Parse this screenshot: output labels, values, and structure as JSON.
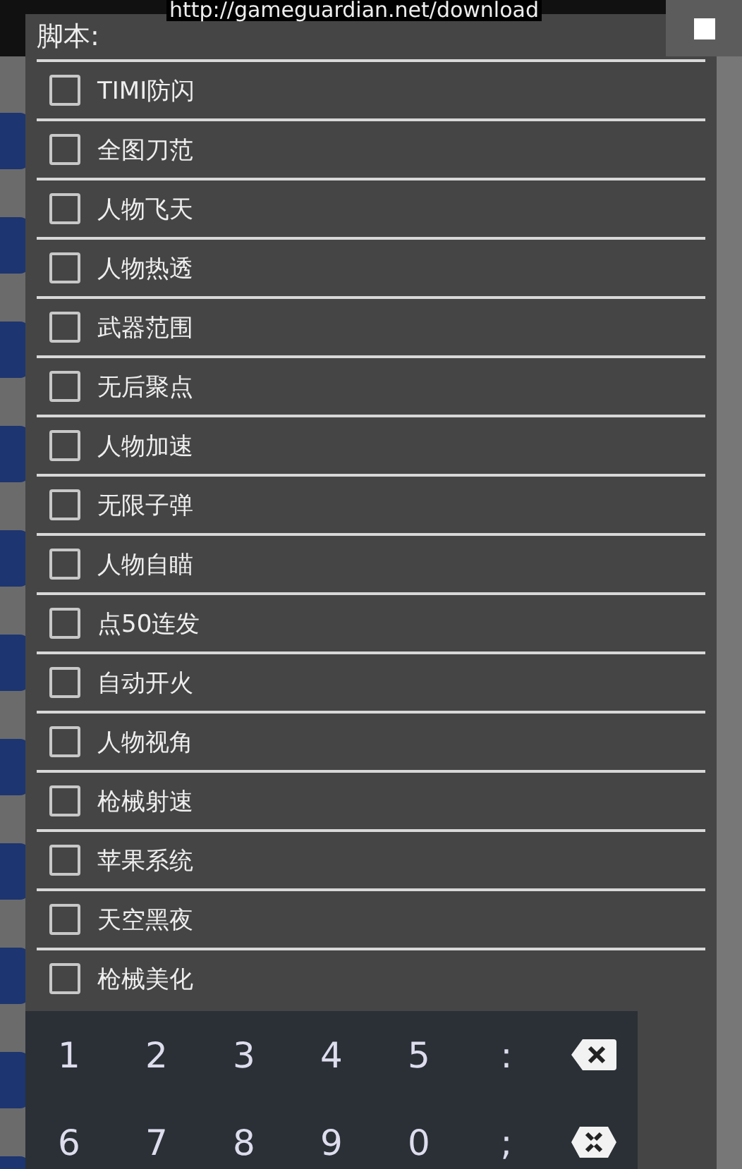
{
  "url_banner": "http://gameguardian.net/download",
  "dialog": {
    "title": "脚本:",
    "items": [
      {
        "label": "TIMI防闪",
        "checked": false
      },
      {
        "label": "全图刀范",
        "checked": false
      },
      {
        "label": "人物飞天",
        "checked": false
      },
      {
        "label": "人物热透",
        "checked": false
      },
      {
        "label": "武器范围",
        "checked": false
      },
      {
        "label": "无后聚点",
        "checked": false
      },
      {
        "label": "人物加速",
        "checked": false
      },
      {
        "label": "无限子弹",
        "checked": false
      },
      {
        "label": "人物自瞄",
        "checked": false
      },
      {
        "label": "点50连发",
        "checked": false
      },
      {
        "label": "自动开火",
        "checked": false
      },
      {
        "label": "人物视角",
        "checked": false
      },
      {
        "label": "枪械射速",
        "checked": false
      },
      {
        "label": "苹果系统",
        "checked": false
      },
      {
        "label": "天空黑夜",
        "checked": false
      },
      {
        "label": "枪械美化",
        "checked": false
      }
    ]
  },
  "keypad": {
    "rows": [
      [
        {
          "kind": "char",
          "label": "1"
        },
        {
          "kind": "char",
          "label": "2"
        },
        {
          "kind": "char",
          "label": "3"
        },
        {
          "kind": "char",
          "label": "4"
        },
        {
          "kind": "char",
          "label": "5"
        },
        {
          "kind": "char",
          "label": ":"
        },
        {
          "kind": "backspace"
        }
      ],
      [
        {
          "kind": "char",
          "label": "6"
        },
        {
          "kind": "char",
          "label": "7"
        },
        {
          "kind": "char",
          "label": "8"
        },
        {
          "kind": "char",
          "label": "9"
        },
        {
          "kind": "char",
          "label": "0"
        },
        {
          "kind": "char",
          "label": ";"
        },
        {
          "kind": "hide"
        }
      ]
    ]
  }
}
